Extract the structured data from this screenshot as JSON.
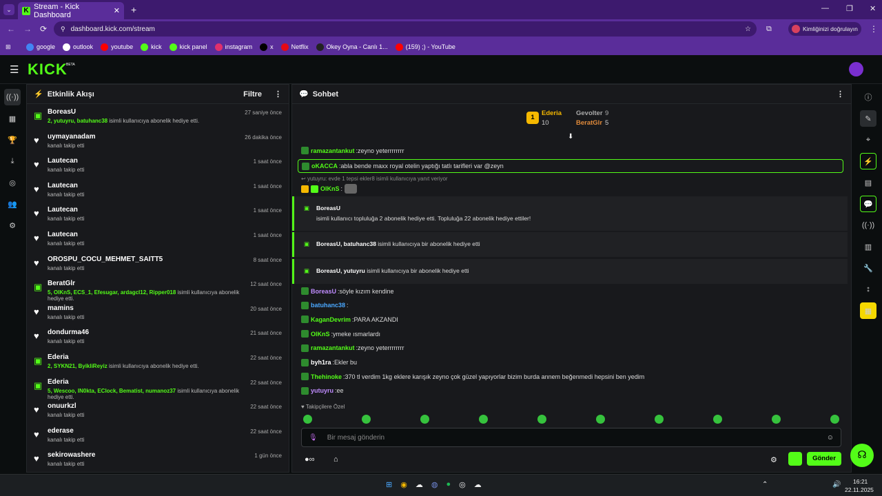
{
  "browser": {
    "tab_title": "Stream - Kick Dashboard",
    "url": "dashboard.kick.com/stream",
    "profile_label": "Kimliğinizi doğrulayın",
    "bookmarks": [
      {
        "label": "google",
        "color": "#4285f4"
      },
      {
        "label": "outlook",
        "color": "#ffffff"
      },
      {
        "label": "youtube",
        "color": "#ff0000"
      },
      {
        "label": "kick",
        "color": "#53fc18"
      },
      {
        "label": "kick panel",
        "color": "#53fc18"
      },
      {
        "label": "instagram",
        "color": "#e1306c"
      },
      {
        "label": "x",
        "color": "#000000"
      },
      {
        "label": "Netflix",
        "color": "#e50914"
      },
      {
        "label": "Okey Oyna - Canlı 1...",
        "color": "#222222"
      },
      {
        "label": "(159) ;) - YouTube",
        "color": "#ff0000"
      }
    ]
  },
  "app": {
    "logo": "KICK",
    "logo_sup": "BETA",
    "accent": "#53fc18"
  },
  "activity": {
    "title": "Etkinlik Akışı",
    "filter_label": "Filtre",
    "items": [
      {
        "icon": "gift-icon",
        "name": "BoreasU",
        "highlight": "2, yutuyru, batuhanc38",
        "rest": " isimli kullanıcıya abonelik hediye etti.",
        "time": "27 saniye önce"
      },
      {
        "icon": "heart-icon",
        "name": "uymayanadam",
        "highlight": "",
        "rest": "kanalı takip etti",
        "time": "26 dakika önce"
      },
      {
        "icon": "heart-icon",
        "name": "Lautecan",
        "highlight": "",
        "rest": "kanalı takip etti",
        "time": "1 saat önce"
      },
      {
        "icon": "heart-icon",
        "name": "Lautecan",
        "highlight": "",
        "rest": "kanalı takip etti",
        "time": "1 saat önce"
      },
      {
        "icon": "heart-icon",
        "name": "Lautecan",
        "highlight": "",
        "rest": "kanalı takip etti",
        "time": "1 saat önce"
      },
      {
        "icon": "heart-icon",
        "name": "Lautecan",
        "highlight": "",
        "rest": "kanalı takip etti",
        "time": "1 saat önce"
      },
      {
        "icon": "heart-icon",
        "name": "OROSPU_COCU_MEHMET_SAITT5",
        "highlight": "",
        "rest": "kanalı takip etti",
        "time": "8 saat önce"
      },
      {
        "icon": "gift-icon",
        "name": "BeratGlr",
        "highlight": "5, OlKnS, ECS_1, Efesugar, ardagcl12, Ripper018",
        "rest": " isimli kullanıcıya abonelik hediye etti.",
        "time": "12 saat önce"
      },
      {
        "icon": "heart-icon",
        "name": "mamins",
        "highlight": "",
        "rest": "kanalı takip etti",
        "time": "20 saat önce"
      },
      {
        "icon": "heart-icon",
        "name": "dondurma46",
        "highlight": "",
        "rest": "kanalı takip etti",
        "time": "21 saat önce"
      },
      {
        "icon": "gift-icon",
        "name": "Ederia",
        "highlight": "2, SYKN21, ByikliReyiz",
        "rest": " isimli kullanıcıya abonelik hediye etti.",
        "time": "22 saat önce"
      },
      {
        "icon": "gift-icon",
        "name": "Ederia",
        "highlight": "5, Wescoo, IN0kta, EClock, Bematist, numanoz37",
        "rest": " isimli kullanıcıya abonelik hediye etti.",
        "time": "22 saat önce"
      },
      {
        "icon": "heart-icon",
        "name": "onuurkzl",
        "highlight": "",
        "rest": "kanalı takip etti",
        "time": "22 saat önce"
      },
      {
        "icon": "heart-icon",
        "name": "ederase",
        "highlight": "",
        "rest": "kanalı takip etti",
        "time": "22 saat önce"
      },
      {
        "icon": "heart-icon",
        "name": "sekirowashere",
        "highlight": "",
        "rest": "kanalı takip etti",
        "time": "1 gün önce"
      }
    ]
  },
  "chat": {
    "title": "Sohbet",
    "leaderboard": {
      "first_rank": "1",
      "first_name": "Ederia",
      "first_count": "10",
      "second_name": "Gevolter",
      "second_count": "9",
      "third_name": "BeratGlr",
      "third_count": "5"
    },
    "messages_top": [
      {
        "user": "ramazantankut",
        "color": "#53fc18",
        "text": "zeyno yeterrrrrrrr"
      },
      {
        "user": "oKACCA",
        "color": "#53fc18",
        "text": "abla bende maxx royal otelin yaptığı tatlı tarifleri var @zeyn"
      }
    ],
    "reply_note": "yutuyru: evde 1 tepsi ekler8 isimli kullanıcıya yanıt veriyor",
    "reply_msg": {
      "user": "OlKnS",
      "color": "#53fc18",
      "text": ""
    },
    "subcard1": {
      "name": "BoreasU",
      "text": "isimli kullanıcı topluluğa 2 abonelik hediye etti. Topluluğa 22 abonelik hediye ettiler!"
    },
    "subcard2": {
      "names": "BoreasU, batuhanc38",
      "text": " isimli kullanıcıya bir abonelik hediye etti"
    },
    "subcard3": {
      "names": "BoreasU, yutuyru",
      "text": " isimli kullanıcıya bir abonelik hediye etti"
    },
    "messages": [
      {
        "user": "BoreasU",
        "color": "#c08cff",
        "text": "söyle kızım kendine"
      },
      {
        "user": "batuhanc38",
        "color": "#4aa8ff",
        "text": ""
      },
      {
        "user": "KaganDevrim",
        "color": "#53fc18",
        "text": "PARA AKZANDI"
      },
      {
        "user": "OlKnS",
        "color": "#53fc18",
        "text": "ymeke ısmarlardı"
      },
      {
        "user": "ramazantankut",
        "color": "#53fc18",
        "text": "zeyno yeterrrrrrrr"
      },
      {
        "user": "byh1ra",
        "color": "#ffffff",
        "text": "Ekler bu"
      },
      {
        "user": "Thehinoke",
        "color": "#53fc18",
        "text": "370 tl verdim 1kg eklere karışık zeyno çok güzel yapıyorlar bizim burda annem beğenmedi hepsini ben yedim"
      },
      {
        "user": "yutuyru",
        "color": "#c08cff",
        "text": "ee"
      }
    ],
    "followers_only": "Takipçilere Özel",
    "input_placeholder": "Bir mesaj gönderin",
    "send_label": "Gönder"
  },
  "taskbar": {
    "time": "16:21",
    "date": "22.11.2025"
  }
}
